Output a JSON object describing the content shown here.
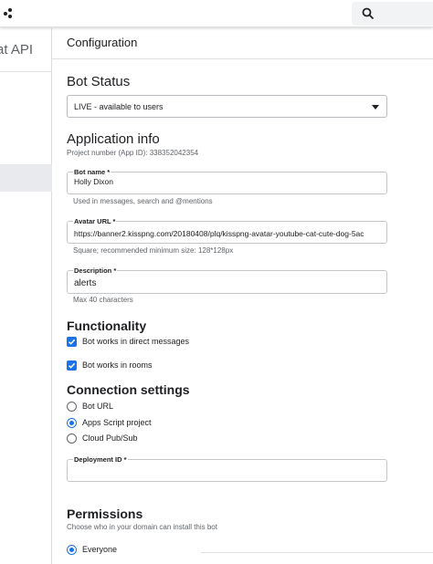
{
  "search": {
    "icon": "search-icon",
    "placeholder": ""
  },
  "sidebar": {
    "title_partial": "at API"
  },
  "header": {
    "title": "Configuration"
  },
  "bot_status": {
    "title": "Bot Status",
    "selected": "LIVE - available to users"
  },
  "app_info": {
    "title": "Application info",
    "project_number": "Project number (App ID): 338352042354",
    "bot_name": {
      "label": "Bot name *",
      "value": "Holly Dixon",
      "helper": "Used in messages, search and @mentions"
    },
    "avatar_url": {
      "label": "Avatar URL *",
      "value": "https://banner2.kisspng.com/20180408/plq/kisspng-avatar-youtube-cat-cute-dog-5ac",
      "helper": "Square; recommended minimum size: 128*128px"
    },
    "description": {
      "label": "Description *",
      "value": "alerts",
      "helper": "Max 40 characters"
    }
  },
  "functionality": {
    "title": "Functionality",
    "options": [
      {
        "label": "Bot works in direct messages",
        "checked": true
      },
      {
        "label": "Bot works in rooms",
        "checked": true
      }
    ]
  },
  "connection": {
    "title": "Connection settings",
    "options": [
      {
        "label": "Bot URL",
        "selected": false
      },
      {
        "label": "Apps Script project",
        "selected": true
      },
      {
        "label": "Cloud Pub/Sub",
        "selected": false
      }
    ],
    "deployment_id": {
      "label": "Deployment ID *",
      "value": ""
    }
  },
  "permissions": {
    "title": "Permissions",
    "subtitle": "Choose who in your domain can install this bot",
    "options": [
      {
        "label": "Everyone",
        "selected": true
      }
    ]
  },
  "colors": {
    "accent": "#1a73e8",
    "text": "#202124",
    "muted": "#5f6368"
  }
}
